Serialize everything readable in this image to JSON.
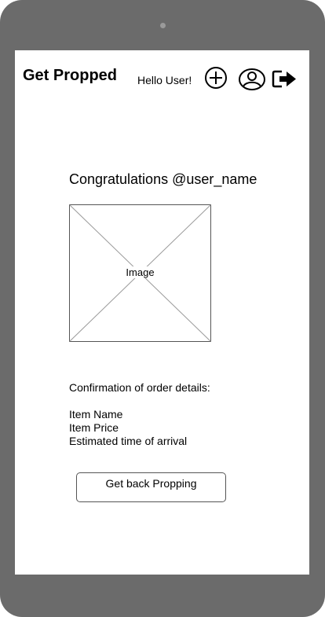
{
  "header": {
    "app_title": "Get Propped",
    "greeting": "Hello User!",
    "icons": {
      "add": "add-circle-icon",
      "profile": "user-profile-icon",
      "logout": "logout-icon"
    }
  },
  "main": {
    "congrats_text": "Congratulations @user_name",
    "image_label": "Image",
    "details_heading": "Confirmation of order details:",
    "details": {
      "item_name": "Item Name",
      "item_price": "Item Price",
      "eta": "Estimated time of arrival"
    },
    "back_button_label": "Get back Propping"
  },
  "colors": {
    "device_frame": "#6b6b6b",
    "screen_bg": "#ffffff",
    "text": "#000000"
  }
}
